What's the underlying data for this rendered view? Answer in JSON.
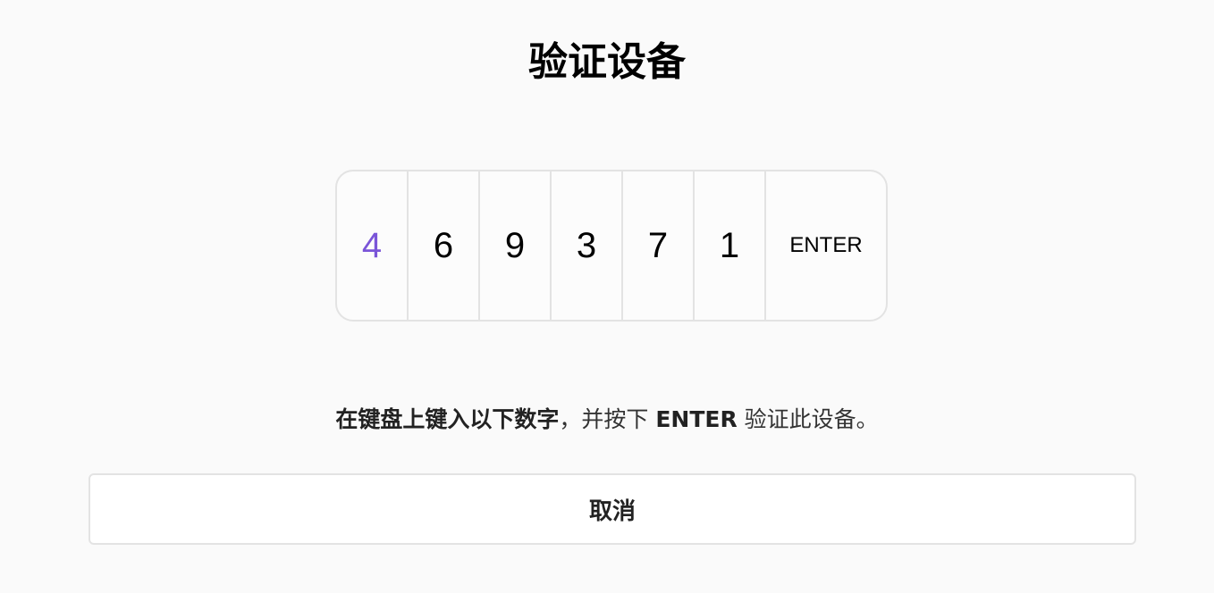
{
  "title": "验证设备",
  "code": {
    "digits": [
      "4",
      "6",
      "9",
      "3",
      "7",
      "1"
    ],
    "enter_label": "ENTER",
    "active_color": "#7a55d8"
  },
  "instructions": {
    "bold_part": "在键盘上键入以下数字",
    "comma": "，",
    "mid": "并按下 ",
    "enter_word": "ENTER",
    "end": " 验证此设备。"
  },
  "cancel_label": "取消"
}
